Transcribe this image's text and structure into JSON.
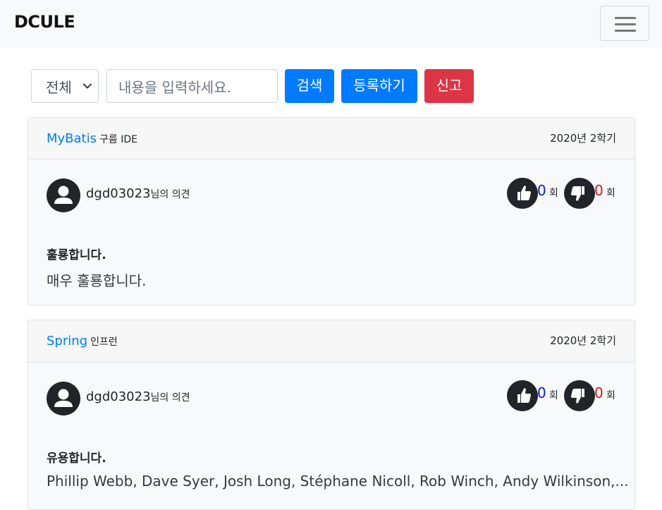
{
  "navbar": {
    "brand": "DCULE"
  },
  "search": {
    "select_value": "전체",
    "placeholder": "내용을 입력하세요.",
    "search_label": "검색",
    "register_label": "등록하기",
    "report_label": "신고"
  },
  "reviews": [
    {
      "course": "MyBatis",
      "course_sub": "구름 IDE",
      "semester": "2020년 2학기",
      "user": "dgd03023",
      "user_suffix": "님의 의견",
      "likes": "0",
      "dislikes": "0",
      "count_unit": "회",
      "title": "훌룡합니다.",
      "content": "매우 훌룡합니다."
    },
    {
      "course": "Spring",
      "course_sub": "인프런",
      "semester": "2020년 2학기",
      "user": "dgd03023",
      "user_suffix": "님의 의견",
      "likes": "0",
      "dislikes": "0",
      "count_unit": "회",
      "title": "유용합니다.",
      "content": "Phillip Webb, Dave Syer, Josh Long, Stéphane Nicoll, Rob Winch, Andy Wilkinson,..."
    }
  ],
  "colors": {
    "primary": "#007bff",
    "danger": "#dc3545",
    "dark": "#212529",
    "like": "#0d21c9",
    "dislike": "#e0141c"
  }
}
